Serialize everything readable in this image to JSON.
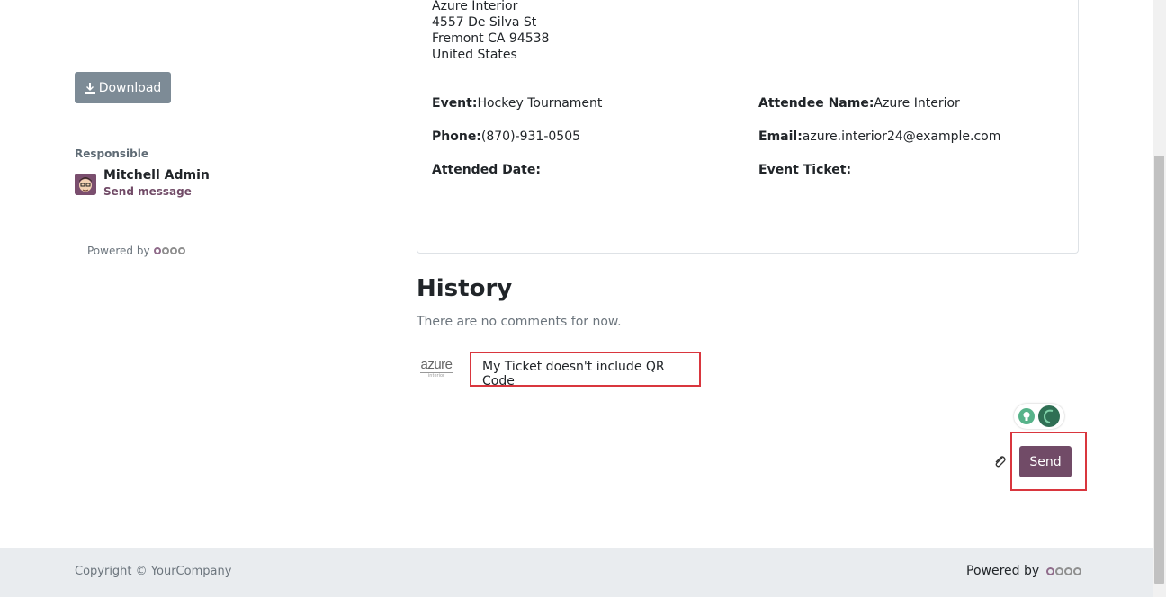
{
  "sidebar": {
    "download_label": "Download",
    "responsible_label": "Responsible",
    "responsible_name": "Mitchell Admin",
    "send_message_label": "Send message",
    "powered_by": "Powered by"
  },
  "ticket": {
    "address": {
      "line1": "Azure Interior",
      "line2": "4557 De Silva St",
      "line3": "Fremont CA 94538",
      "line4": "United States"
    },
    "event_label": "Event:",
    "event_value": "Hockey Tournament",
    "attendee_label": "Attendee Name:",
    "attendee_value": "Azure Interior",
    "phone_label": "Phone:",
    "phone_value": "(870)-931-0505",
    "email_label": "Email:",
    "email_value": "azure.interior24@example.com",
    "attended_date_label": "Attended Date:",
    "event_ticket_label": "Event Ticket:"
  },
  "history": {
    "title": "History",
    "empty_text": "There are no comments for now.",
    "avatar_text": "azure",
    "avatar_subtext": "interior",
    "composer_value": "My Ticket doesn't include QR Code",
    "send_label": "Send"
  },
  "footer": {
    "copyright": "Copyright © YourCompany",
    "powered_by": "Powered by"
  },
  "colors": {
    "brand": "#714b67",
    "highlight": "#d9363e",
    "download_button": "#7d8b96"
  }
}
